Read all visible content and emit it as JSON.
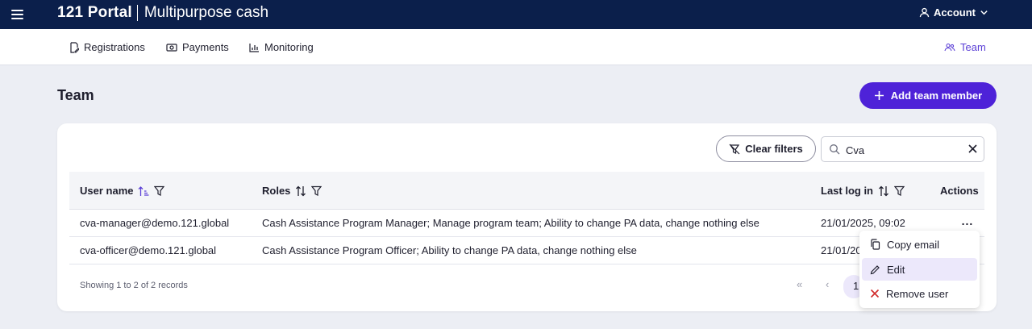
{
  "topbar": {
    "brand": "121 Portal",
    "subtitle": "Multipurpose cash",
    "account_label": "Account",
    "menu_icon": "hamburger-icon"
  },
  "nav": {
    "registrations": "Registrations",
    "payments": "Payments",
    "monitoring": "Monitoring",
    "team": "Team"
  },
  "page": {
    "title": "Team",
    "add_button": "Add team member"
  },
  "filters": {
    "clear_label": "Clear filters",
    "search_value": "Cva"
  },
  "table": {
    "columns": [
      "User name",
      "Roles",
      "Last log in",
      "Actions"
    ],
    "rows": [
      {
        "user": "cva-manager@demo.121.global",
        "roles": "Cash Assistance Program Manager; Manage program team; Ability to change PA data, change nothing else",
        "last_login": "21/01/2025, 09:02",
        "actions": "..."
      },
      {
        "user": "cva-officer@demo.121.global",
        "roles": "Cash Assistance Program Officer; Ability to change PA data, change nothing else",
        "last_login": "21/01/20",
        "actions": ""
      }
    ],
    "footer": "Showing 1 to 2 of 2 records"
  },
  "pagination": {
    "first": "«",
    "prev": "‹",
    "current": "1"
  },
  "context_menu": {
    "copy_email": "Copy email",
    "edit": "Edit",
    "remove_user": "Remove user"
  },
  "colors": {
    "topbar": "#0b1f4b",
    "accent": "#4e22d8",
    "danger": "#d12b2b"
  }
}
